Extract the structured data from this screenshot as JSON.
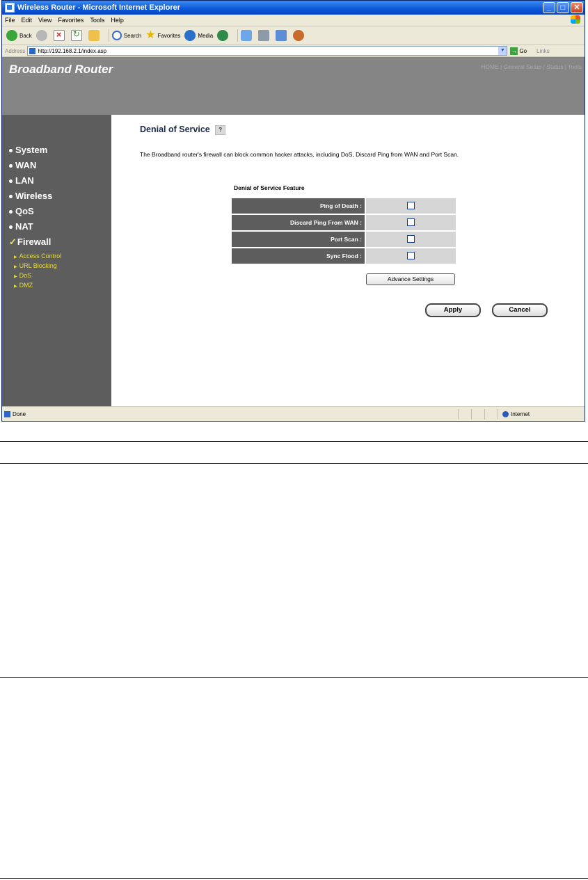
{
  "window": {
    "title": "Wireless Router - Microsoft Internet Explorer",
    "controls": {
      "minimize": "_",
      "maximize": "□",
      "close": "✕"
    }
  },
  "menu": [
    "File",
    "Edit",
    "View",
    "Favorites",
    "Tools",
    "Help"
  ],
  "toolbar": {
    "back": "Back",
    "search": "Search",
    "favorites": "Favorites",
    "media": "Media"
  },
  "address": {
    "label": "Address",
    "url": "http://192.168.2.1/index.asp",
    "go": "Go",
    "links": "Links"
  },
  "router": {
    "brand": "Broadband Router",
    "topnav": "HOME | General Setup | Status | Tools"
  },
  "sidebar": {
    "items": [
      "System",
      "WAN",
      "LAN",
      "Wireless",
      "QoS",
      "NAT"
    ],
    "active": "Firewall",
    "subitems": [
      "Access Control",
      "URL Blocking",
      "DoS",
      "DMZ"
    ]
  },
  "page": {
    "title": "Denial of Service",
    "help": "?",
    "description": "The Broadband router's firewall can block common hacker attacks, including DoS, Discard Ping from WAN and Port Scan.",
    "section_title": "Denial of Service Feature",
    "rows": [
      {
        "label": "Ping of Death :",
        "checked": false
      },
      {
        "label": "Discard Ping From WAN :",
        "checked": false
      },
      {
        "label": "Port Scan :",
        "checked": false
      },
      {
        "label": "Sync Flood :",
        "checked": false
      }
    ],
    "advance_button": "Advance Settings",
    "apply_button": "Apply",
    "cancel_button": "Cancel"
  },
  "status": {
    "text": "Done",
    "zone": "Internet"
  }
}
